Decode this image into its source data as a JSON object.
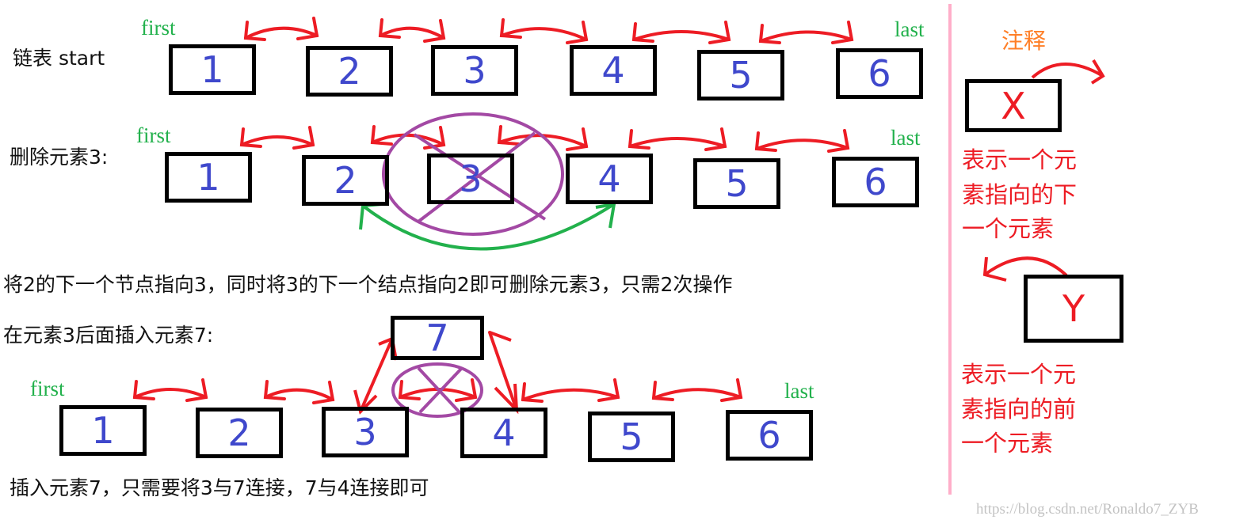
{
  "colors": {
    "box_border": "#000000",
    "node_value": "#3f48cc",
    "link_arrow": "#ed1c24",
    "pointer_label": "#22b14c",
    "cross_out": "#a349a4",
    "bypass_arrow": "#22b14c",
    "divider": "#ffaec9",
    "legend_title": "#ff7f27",
    "legend_text": "#ed1c24",
    "watermark": "#c3c3c3"
  },
  "section1": {
    "label": "链表 start",
    "first_label": "first",
    "last_label": "last",
    "nodes": [
      "1",
      "2",
      "3",
      "4",
      "5",
      "6"
    ]
  },
  "section2": {
    "label": "删除元素3:",
    "first_label": "first",
    "last_label": "last",
    "nodes": [
      "1",
      "2",
      "3",
      "4",
      "5",
      "6"
    ],
    "deleted_node": "3",
    "caption": "将2的下一个节点指向3，同时将3的下一个结点指向2即可删除元素3，只需2次操作"
  },
  "section3": {
    "label": "在元素3后面插入元素7:",
    "first_label": "first",
    "last_label": "last",
    "nodes": [
      "1",
      "2",
      "3",
      "4",
      "5",
      "6"
    ],
    "inserted_node": "7",
    "caption": "插入元素7，只需要将3与7连接，7与4连接即可"
  },
  "legend": {
    "title": "注释",
    "next_box_label": "X",
    "next_desc": [
      "表示一个元",
      "素指向的下",
      "一个元素"
    ],
    "prev_box_label": "Y",
    "prev_desc": [
      "表示一个元",
      "素指向的前",
      "一个元素"
    ]
  },
  "watermark": "https://blog.csdn.net/Ronaldo7_ZYB"
}
